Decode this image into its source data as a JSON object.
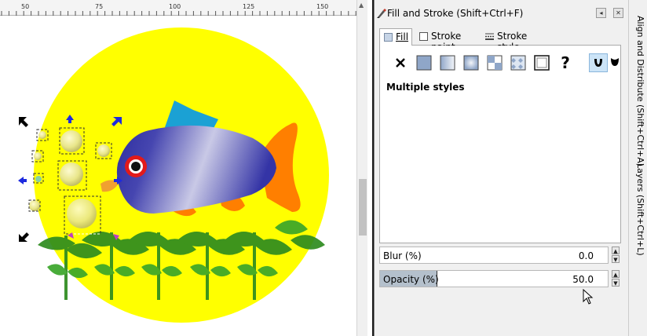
{
  "ruler": {
    "labels": [
      "50",
      "75",
      "100",
      "125",
      "150"
    ]
  },
  "panel": {
    "title": "Fill and Stroke (Shift+Ctrl+F)",
    "collapse_icon": "collapse-arrow-icon",
    "close_icon": "close-icon",
    "tabs": [
      {
        "label": "Fill",
        "icon": "fill-icon",
        "active": true
      },
      {
        "label": "Stroke paint",
        "icon": "stroke-paint-icon",
        "active": false
      },
      {
        "label": "Stroke style",
        "icon": "stroke-style-icon",
        "active": false
      }
    ],
    "paint_buttons": [
      {
        "name": "no-paint",
        "glyph": "✕"
      },
      {
        "name": "flat-color"
      },
      {
        "name": "linear-gradient"
      },
      {
        "name": "radial-gradient"
      },
      {
        "name": "pattern"
      },
      {
        "name": "swatch"
      },
      {
        "name": "unset-paint",
        "glyph": "?"
      },
      {
        "name": "fill-rule-evenodd",
        "active": true
      },
      {
        "name": "fill-rule-nonzero"
      }
    ],
    "status": "Multiple styles",
    "blur": {
      "label": "Blur (%)",
      "value": "0.0",
      "fraction": 0
    },
    "opacity": {
      "label": "Opacity (%)",
      "value": "50.0",
      "fraction": 0.5
    }
  },
  "side_tabs": {
    "align": "Align and Distribute (Shift+Ctrl+A)",
    "layers": "Layers (Shift+Ctrl+L)"
  },
  "colors": {
    "sun": "#ffff00",
    "fin_blue": "#1ba1d4",
    "fin_orange": "#ff7f00",
    "fish_body_light": "#d8d8ec",
    "fish_body_dark": "#2d2d9f",
    "eye_red": "#e21a1a",
    "plant_green": "#2e8b1f",
    "bubble": "#f4f2a0",
    "selection_handle": "#1d2adf",
    "accent_highlight": "#b4c0cc"
  }
}
